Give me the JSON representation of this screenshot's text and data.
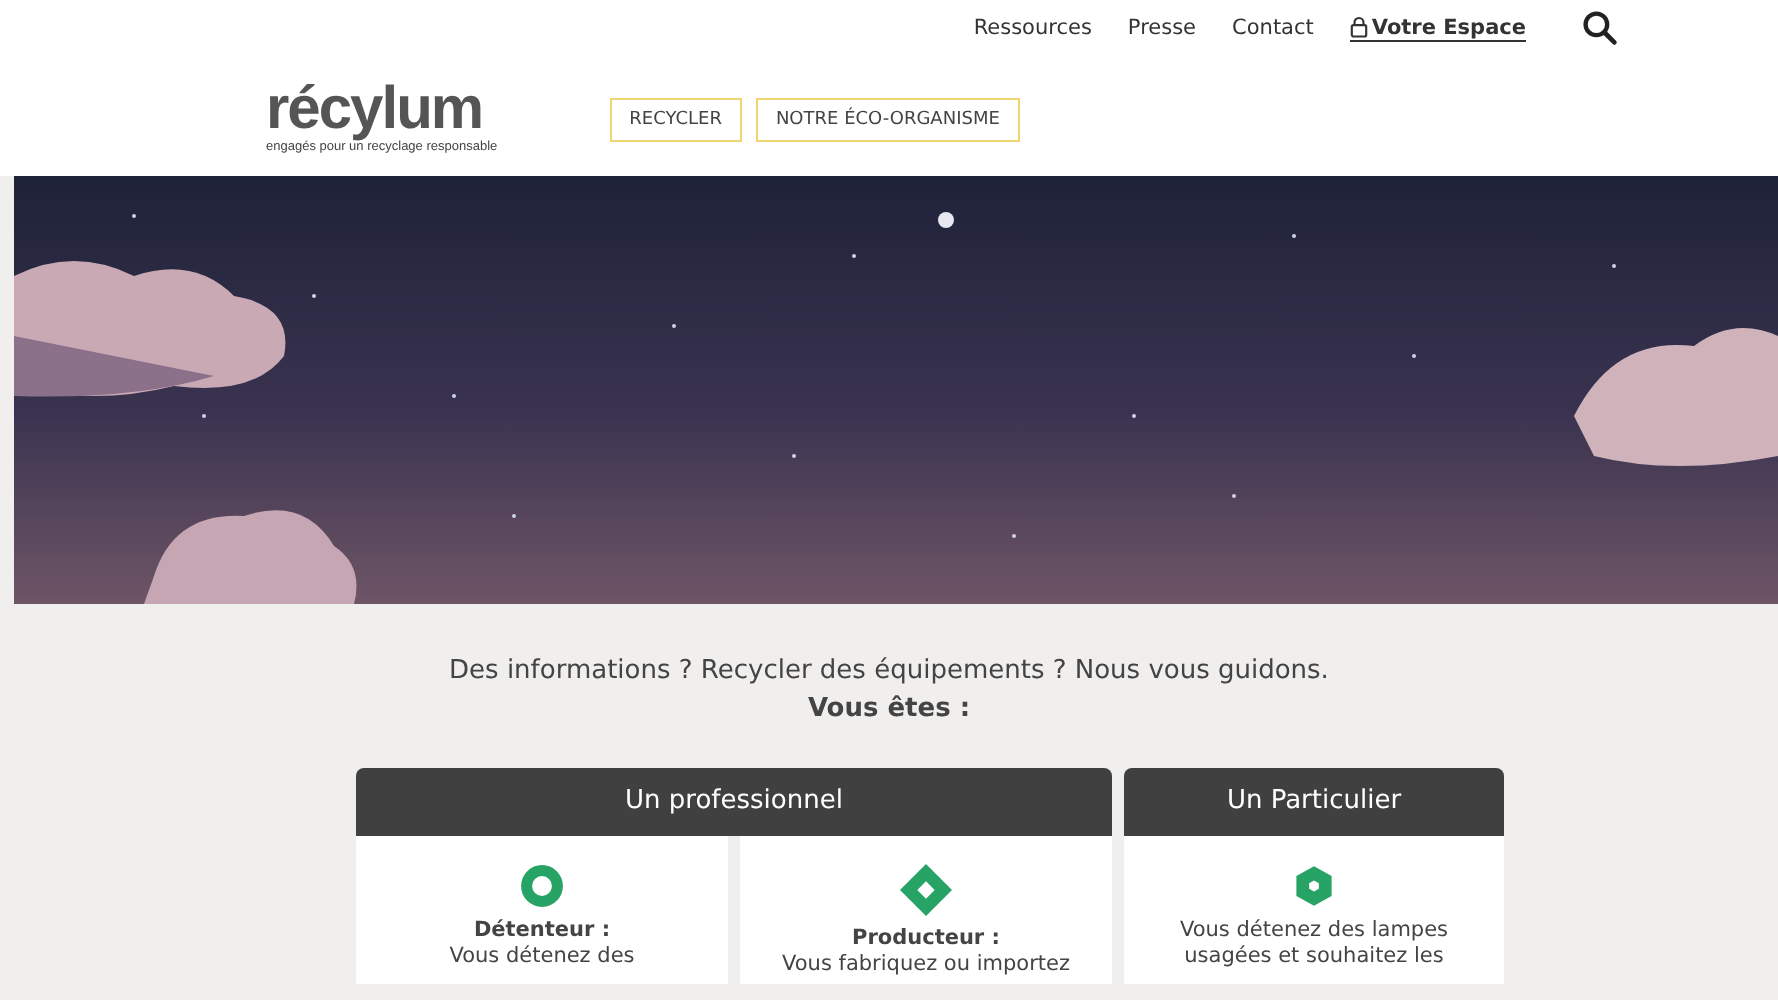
{
  "top_nav": {
    "links": [
      "Ressources",
      "Presse",
      "Contact"
    ],
    "account_link": "Votre Espace"
  },
  "logo": {
    "name": "récylum",
    "tagline": "engagés pour un recyclage responsable"
  },
  "main_nav": [
    "RECYCLER",
    "NOTRE ÉCO-ORGANISME"
  ],
  "hero": {
    "kind": "picture"
  },
  "intro": {
    "text": "Des informations ? Recycler des équipements ? Nous vous guidons.",
    "subtitle": "Vous êtes :"
  },
  "groups": [
    {
      "title": "Un professionnel",
      "cards": [
        {
          "kind": "ring",
          "title": "Détenteur :",
          "text": "Vous détenez des"
        },
        {
          "kind": "diamond",
          "title": "Producteur :",
          "text": "Vous fabriquez ou importez"
        }
      ]
    },
    {
      "title": "Un Particulier",
      "cards": [
        {
          "kind": "hexagon",
          "text": "Vous détenez des lampes usagées et souhaitez les"
        }
      ]
    }
  ]
}
